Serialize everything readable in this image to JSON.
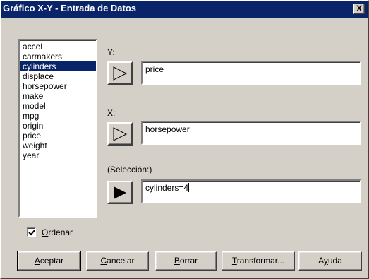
{
  "window": {
    "title": "Gráfico X-Y - Entrada de Datos",
    "close_label": "X"
  },
  "variables": {
    "items": [
      "accel",
      "carmakers",
      "cylinders",
      "displace",
      "horsepower",
      "make",
      "model",
      "mpg",
      "origin",
      "price",
      "weight",
      "year"
    ],
    "selected": "cylinders"
  },
  "y": {
    "label": "Y:",
    "value": "price"
  },
  "x": {
    "label": "X:",
    "value": "horsepower"
  },
  "selection": {
    "label": "(Selección:)",
    "value": "cylinders=4"
  },
  "sort": {
    "checked": true,
    "label_mnemonic": "O",
    "label_rest": "rdenar"
  },
  "buttons": {
    "accept": {
      "mnemonic": "A",
      "rest": "ceptar"
    },
    "cancel": {
      "mnemonic": "C",
      "rest": "ancelar"
    },
    "clear": {
      "mnemonic": "B",
      "rest": "orrar"
    },
    "transform": {
      "mnemonic": "T",
      "rest": "ransformar..."
    },
    "help": {
      "pre": "A",
      "mnemonic": "y",
      "rest": "uda"
    }
  },
  "colors": {
    "titlebar": "#0a246a",
    "selection_highlight": "#0a246a",
    "dialog_face": "#d4d0c8"
  }
}
